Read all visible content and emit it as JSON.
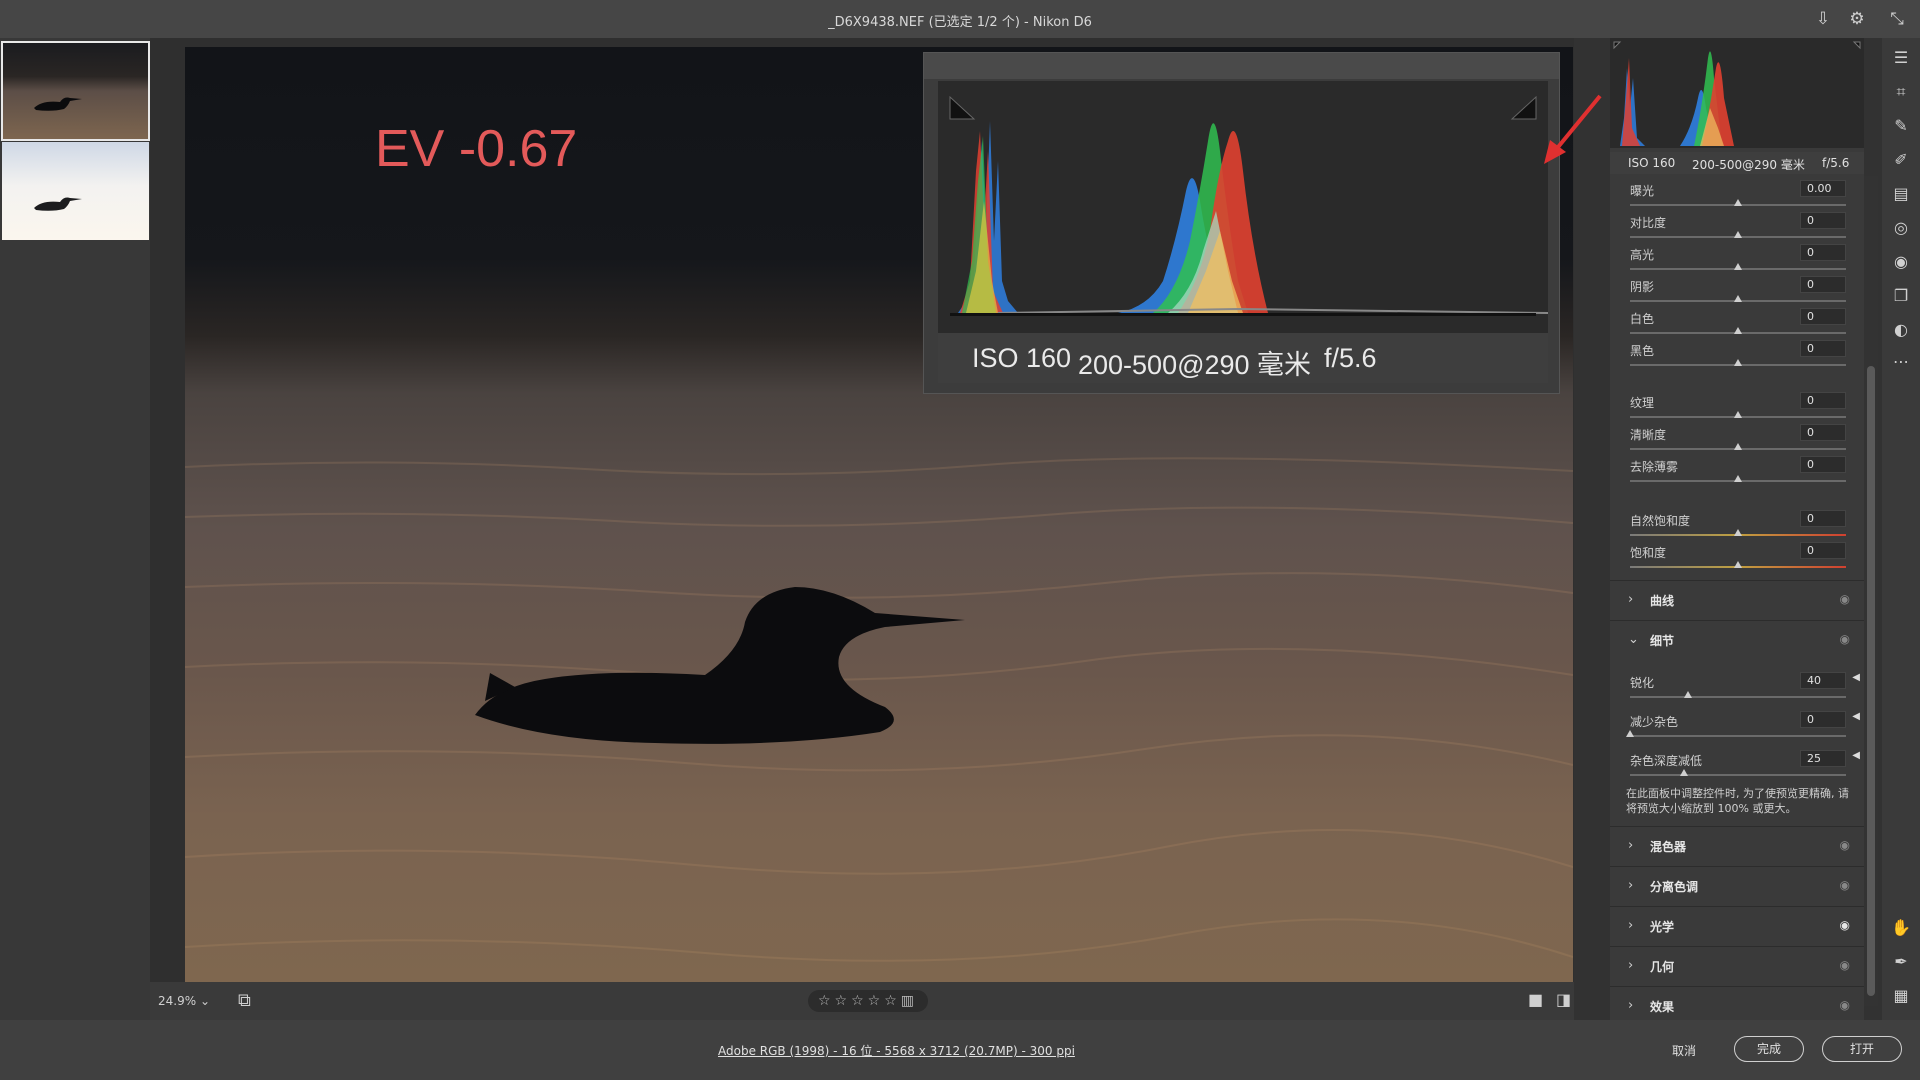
{
  "window": {
    "title": "_D6X9438.NEF (已选定 1/2 个) - Nikon D6"
  },
  "photo": {
    "ev_label": "EV -0.67"
  },
  "hist_inset": {
    "iso": "ISO 160",
    "lens": "200-500@290 毫米",
    "aperture": "f/5.6"
  },
  "panel_info": {
    "iso": "ISO 160",
    "lens": "200-500@290 毫米",
    "aperture": "f/5.6"
  },
  "basic": [
    {
      "label": "曝光",
      "value": "0.00",
      "level": 0.5
    },
    {
      "label": "对比度",
      "value": "0",
      "level": 0.5
    },
    {
      "label": "高光",
      "value": "0",
      "level": 0.5
    },
    {
      "label": "阴影",
      "value": "0",
      "level": 0.5
    },
    {
      "label": "白色",
      "value": "0",
      "level": 0.5
    },
    {
      "label": "黑色",
      "value": "0",
      "level": 0.5
    }
  ],
  "presence": [
    {
      "label": "纹理",
      "value": "0",
      "level": 0.5
    },
    {
      "label": "清晰度",
      "value": "0",
      "level": 0.5
    },
    {
      "label": "去除薄雾",
      "value": "0",
      "level": 0.5
    }
  ],
  "color": [
    {
      "label": "自然饱和度",
      "value": "0",
      "level": 0.5
    },
    {
      "label": "饱和度",
      "value": "0",
      "level": 0.5
    }
  ],
  "sections": {
    "curves": "曲线",
    "detail": "细节",
    "mixer": "混色器",
    "split": "分离色调",
    "optics": "光学",
    "geometry": "几何",
    "effects": "效果"
  },
  "detail": [
    {
      "label": "锐化",
      "value": "40",
      "level": 0.27
    },
    {
      "label": "减少杂色",
      "value": "0",
      "level": 0.0
    },
    {
      "label": "杂色深度减低",
      "value": "25",
      "level": 0.25
    }
  ],
  "detail_note": "在此面板中调整控件时, 为了使预览更精确, 请将预览大小缩放到 100% 或更大。",
  "bottombar": {
    "zoom": "24.9%"
  },
  "status": {
    "file_info": "Adobe RGB (1998) - 16 位 - 5568 x 3712 (20.7MP) - 300 ppi",
    "cancel": "取消",
    "done": "完成",
    "open": "打开"
  },
  "icons": {
    "save": "save-icon",
    "settings": "gear-icon",
    "collapse": "collapse-icon"
  }
}
